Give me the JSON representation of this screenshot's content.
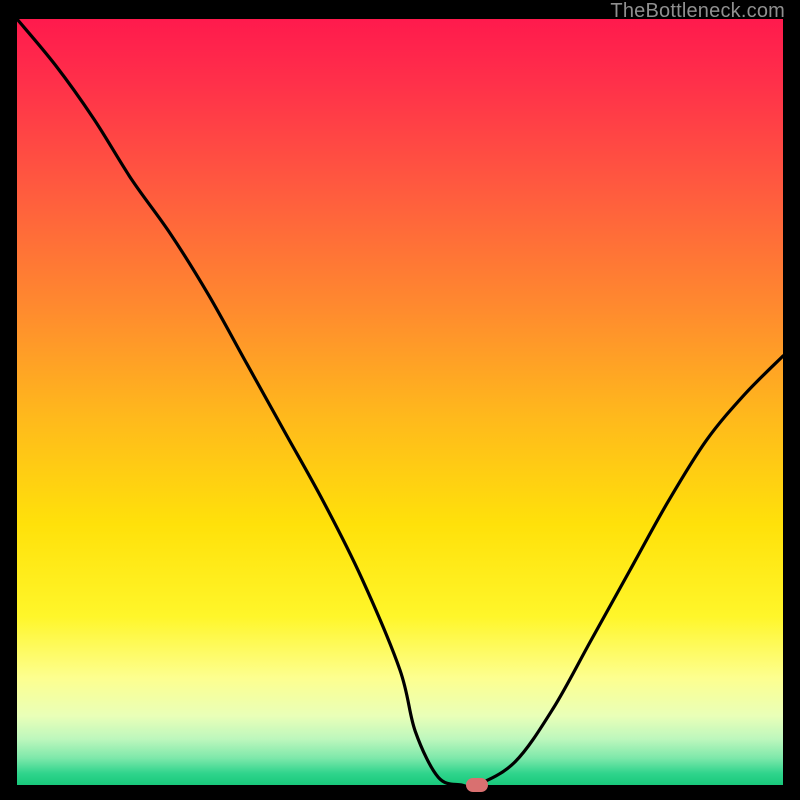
{
  "watermark": "TheBottleneck.com",
  "colors": {
    "frame": "#000000",
    "gradient_top": "#ff1a4d",
    "gradient_bottom": "#18c87b",
    "curve": "#000000",
    "marker": "#d97070"
  },
  "chart_data": {
    "type": "line",
    "title": "",
    "xlabel": "",
    "ylabel": "",
    "xlim": [
      0,
      100
    ],
    "ylim": [
      0,
      100
    ],
    "grid": false,
    "x": [
      0,
      5,
      10,
      15,
      20,
      25,
      30,
      35,
      40,
      45,
      50,
      52,
      55,
      58,
      60,
      65,
      70,
      75,
      80,
      85,
      90,
      95,
      100
    ],
    "values": [
      100,
      94,
      87,
      79,
      72,
      64,
      55,
      46,
      37,
      27,
      15,
      7,
      1,
      0,
      0,
      3,
      10,
      19,
      28,
      37,
      45,
      51,
      56
    ],
    "marker": {
      "x": 60,
      "y": 0
    },
    "notes": "Axes unlabeled in source image; x and y expressed as 0–100 percent of plot area. Curve descends steeply from top-left, reaches zero near x≈58–60, then rises toward right edge ending near y≈56."
  }
}
